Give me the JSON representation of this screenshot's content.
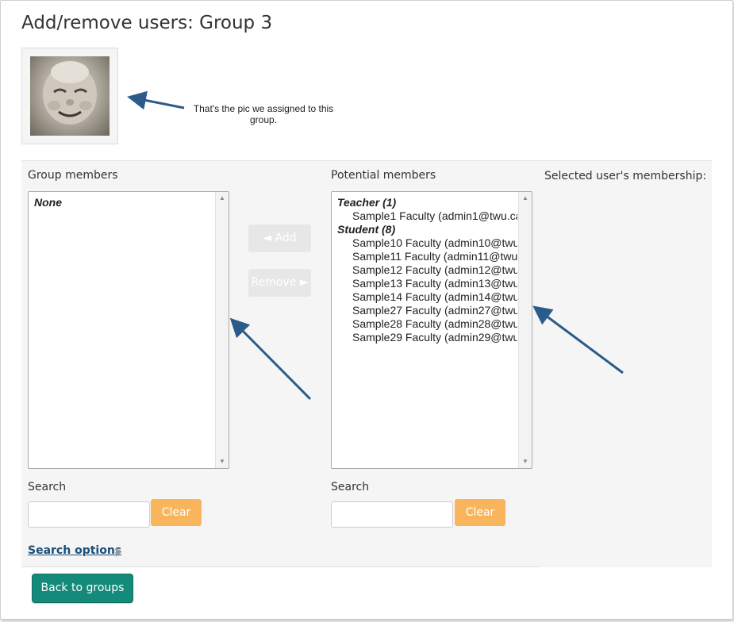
{
  "page": {
    "title": "Add/remove users: Group 3"
  },
  "annotation": {
    "text": "That's the pic we assigned to this group."
  },
  "group_members": {
    "label": "Group members",
    "empty_text": "None"
  },
  "controls": {
    "add_label": "◄ Add",
    "remove_label": "Remove ►"
  },
  "potential_members": {
    "label": "Potential members",
    "groups": [
      {
        "heading": "Teacher (1)",
        "items": [
          "Sample1 Faculty (admin1@twu.ca"
        ]
      },
      {
        "heading": "Student (8)",
        "items": [
          "Sample10 Faculty (admin10@twu.",
          "Sample11 Faculty (admin11@twu.",
          "Sample12 Faculty (admin12@twu.",
          "Sample13 Faculty (admin13@twu.",
          "Sample14 Faculty (admin14@twu.",
          "Sample27 Faculty (admin27@twu.",
          "Sample28 Faculty (admin28@twu.",
          "Sample29 Faculty (admin29@twu."
        ]
      }
    ]
  },
  "membership": {
    "label": "Selected user's membership:"
  },
  "search": {
    "left": {
      "label": "Search",
      "value": "",
      "clear_label": "Clear"
    },
    "right": {
      "label": "Search",
      "value": "",
      "clear_label": "Clear"
    },
    "options_label": "Search options"
  },
  "footer": {
    "back_label": "Back to groups"
  },
  "colors": {
    "accent_orange": "#f8b55c",
    "accent_teal": "#138a7a",
    "arrow_blue": "#2b5b8a"
  },
  "icons": [
    "scroll-up-icon",
    "scroll-down-icon",
    "expand-triangle-icon"
  ]
}
